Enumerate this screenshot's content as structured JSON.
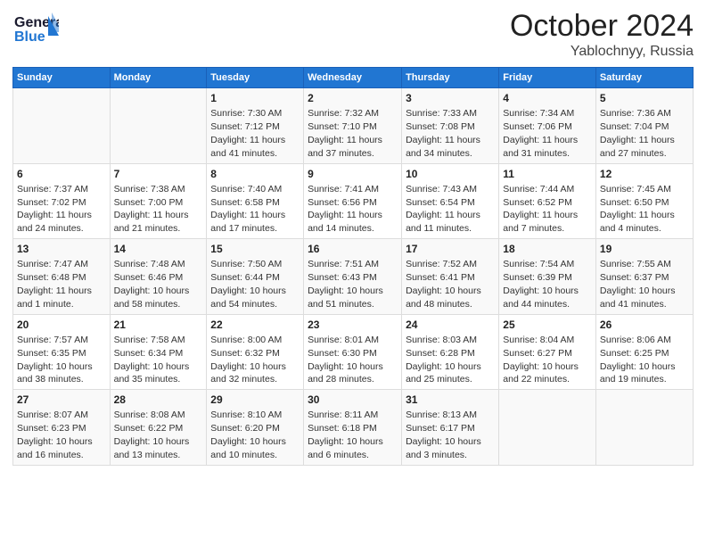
{
  "header": {
    "logo_line1": "General",
    "logo_line2": "Blue",
    "title": "October 2024",
    "subtitle": "Yablochnyy, Russia"
  },
  "columns": [
    "Sunday",
    "Monday",
    "Tuesday",
    "Wednesday",
    "Thursday",
    "Friday",
    "Saturday"
  ],
  "weeks": [
    [
      {
        "day": "",
        "info": ""
      },
      {
        "day": "",
        "info": ""
      },
      {
        "day": "1",
        "info": "Sunrise: 7:30 AM\nSunset: 7:12 PM\nDaylight: 11 hours and 41 minutes."
      },
      {
        "day": "2",
        "info": "Sunrise: 7:32 AM\nSunset: 7:10 PM\nDaylight: 11 hours and 37 minutes."
      },
      {
        "day": "3",
        "info": "Sunrise: 7:33 AM\nSunset: 7:08 PM\nDaylight: 11 hours and 34 minutes."
      },
      {
        "day": "4",
        "info": "Sunrise: 7:34 AM\nSunset: 7:06 PM\nDaylight: 11 hours and 31 minutes."
      },
      {
        "day": "5",
        "info": "Sunrise: 7:36 AM\nSunset: 7:04 PM\nDaylight: 11 hours and 27 minutes."
      }
    ],
    [
      {
        "day": "6",
        "info": "Sunrise: 7:37 AM\nSunset: 7:02 PM\nDaylight: 11 hours and 24 minutes."
      },
      {
        "day": "7",
        "info": "Sunrise: 7:38 AM\nSunset: 7:00 PM\nDaylight: 11 hours and 21 minutes."
      },
      {
        "day": "8",
        "info": "Sunrise: 7:40 AM\nSunset: 6:58 PM\nDaylight: 11 hours and 17 minutes."
      },
      {
        "day": "9",
        "info": "Sunrise: 7:41 AM\nSunset: 6:56 PM\nDaylight: 11 hours and 14 minutes."
      },
      {
        "day": "10",
        "info": "Sunrise: 7:43 AM\nSunset: 6:54 PM\nDaylight: 11 hours and 11 minutes."
      },
      {
        "day": "11",
        "info": "Sunrise: 7:44 AM\nSunset: 6:52 PM\nDaylight: 11 hours and 7 minutes."
      },
      {
        "day": "12",
        "info": "Sunrise: 7:45 AM\nSunset: 6:50 PM\nDaylight: 11 hours and 4 minutes."
      }
    ],
    [
      {
        "day": "13",
        "info": "Sunrise: 7:47 AM\nSunset: 6:48 PM\nDaylight: 11 hours and 1 minute."
      },
      {
        "day": "14",
        "info": "Sunrise: 7:48 AM\nSunset: 6:46 PM\nDaylight: 10 hours and 58 minutes."
      },
      {
        "day": "15",
        "info": "Sunrise: 7:50 AM\nSunset: 6:44 PM\nDaylight: 10 hours and 54 minutes."
      },
      {
        "day": "16",
        "info": "Sunrise: 7:51 AM\nSunset: 6:43 PM\nDaylight: 10 hours and 51 minutes."
      },
      {
        "day": "17",
        "info": "Sunrise: 7:52 AM\nSunset: 6:41 PM\nDaylight: 10 hours and 48 minutes."
      },
      {
        "day": "18",
        "info": "Sunrise: 7:54 AM\nSunset: 6:39 PM\nDaylight: 10 hours and 44 minutes."
      },
      {
        "day": "19",
        "info": "Sunrise: 7:55 AM\nSunset: 6:37 PM\nDaylight: 10 hours and 41 minutes."
      }
    ],
    [
      {
        "day": "20",
        "info": "Sunrise: 7:57 AM\nSunset: 6:35 PM\nDaylight: 10 hours and 38 minutes."
      },
      {
        "day": "21",
        "info": "Sunrise: 7:58 AM\nSunset: 6:34 PM\nDaylight: 10 hours and 35 minutes."
      },
      {
        "day": "22",
        "info": "Sunrise: 8:00 AM\nSunset: 6:32 PM\nDaylight: 10 hours and 32 minutes."
      },
      {
        "day": "23",
        "info": "Sunrise: 8:01 AM\nSunset: 6:30 PM\nDaylight: 10 hours and 28 minutes."
      },
      {
        "day": "24",
        "info": "Sunrise: 8:03 AM\nSunset: 6:28 PM\nDaylight: 10 hours and 25 minutes."
      },
      {
        "day": "25",
        "info": "Sunrise: 8:04 AM\nSunset: 6:27 PM\nDaylight: 10 hours and 22 minutes."
      },
      {
        "day": "26",
        "info": "Sunrise: 8:06 AM\nSunset: 6:25 PM\nDaylight: 10 hours and 19 minutes."
      }
    ],
    [
      {
        "day": "27",
        "info": "Sunrise: 8:07 AM\nSunset: 6:23 PM\nDaylight: 10 hours and 16 minutes."
      },
      {
        "day": "28",
        "info": "Sunrise: 8:08 AM\nSunset: 6:22 PM\nDaylight: 10 hours and 13 minutes."
      },
      {
        "day": "29",
        "info": "Sunrise: 8:10 AM\nSunset: 6:20 PM\nDaylight: 10 hours and 10 minutes."
      },
      {
        "day": "30",
        "info": "Sunrise: 8:11 AM\nSunset: 6:18 PM\nDaylight: 10 hours and 6 minutes."
      },
      {
        "day": "31",
        "info": "Sunrise: 8:13 AM\nSunset: 6:17 PM\nDaylight: 10 hours and 3 minutes."
      },
      {
        "day": "",
        "info": ""
      },
      {
        "day": "",
        "info": ""
      }
    ]
  ]
}
